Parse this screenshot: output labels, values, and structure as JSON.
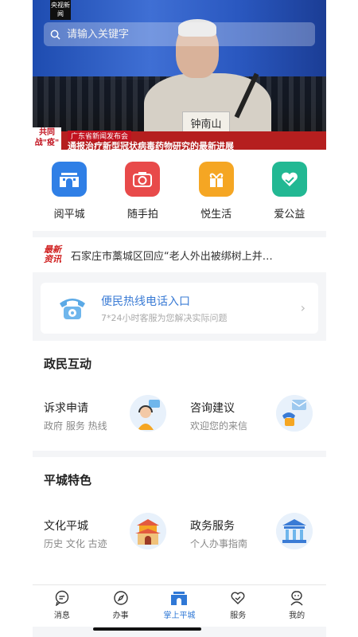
{
  "status_bar": {
    "time": "",
    "right_text": ""
  },
  "hero": {
    "logo": "央视新闻",
    "nameplate": "钟南山",
    "caption_tag": "共同战\"疫\"",
    "caption_top": "广东省新闻发布会",
    "caption_main": "通报治疗新型冠状病毒药物研究的最新进展"
  },
  "search": {
    "placeholder": "请输入关键字"
  },
  "quick_services": [
    {
      "label": "阅平城",
      "icon": "city-gate-icon",
      "color": "#2f7fe6"
    },
    {
      "label": "随手拍",
      "icon": "camera-icon",
      "color": "#e84a4a"
    },
    {
      "label": "悦生活",
      "icon": "gift-icon",
      "color": "#f5a623"
    },
    {
      "label": "爱公益",
      "icon": "heart-hand-icon",
      "color": "#22b893"
    }
  ],
  "news": {
    "badge_line1": "最新",
    "badge_line2": "资讯",
    "text": "石家庄市藁城区回应“老人外出被绑树上并…"
  },
  "hotline": {
    "title": "便民热线电话入口",
    "subtitle": "7*24小时客服为您解决实际问题"
  },
  "interaction": {
    "title": "政民互动",
    "items": [
      {
        "title": "诉求申请",
        "subtitle": "政府 服务 热线"
      },
      {
        "title": "咨询建议",
        "subtitle": "欢迎您的来信"
      }
    ]
  },
  "features": {
    "title": "平城特色",
    "items": [
      {
        "title": "文化平城",
        "subtitle": "历史 文化 古迹"
      },
      {
        "title": "政务服务",
        "subtitle": "个人办事指南"
      }
    ]
  },
  "tabbar": [
    {
      "label": "消息",
      "icon": "message-icon"
    },
    {
      "label": "办事",
      "icon": "compass-icon"
    },
    {
      "label": "掌上平城",
      "icon": "city-gate-icon",
      "active": true
    },
    {
      "label": "服务",
      "icon": "heart-icon"
    },
    {
      "label": "我的",
      "icon": "profile-icon"
    }
  ],
  "colors": {
    "accent": "#2f78d6"
  }
}
